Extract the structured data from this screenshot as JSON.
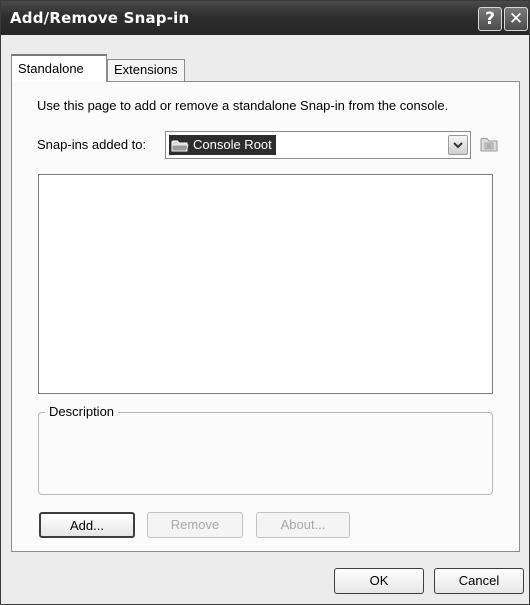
{
  "window": {
    "title": "Add/Remove Snap-in",
    "help_glyph": "?",
    "close_glyph": "✕"
  },
  "tabs": [
    {
      "label": "Standalone",
      "selected": true
    },
    {
      "label": "Extensions",
      "selected": false
    }
  ],
  "standalone": {
    "intro_text": "Use this page to add or remove a standalone Snap-in from the console.",
    "snapins_label": "Snap-ins added to:",
    "snapins_value": "Console Root",
    "snapins_value_icon": "folder-icon",
    "list_items": [],
    "description_label": "Description",
    "description_text": "",
    "buttons": {
      "add": "Add...",
      "remove": "Remove",
      "about": "About..."
    }
  },
  "footer": {
    "ok": "OK",
    "cancel": "Cancel"
  },
  "colors": {
    "titlebar": "#2e2e2e",
    "selection": "#2d2d2d",
    "dialog_bg": "#ececec"
  }
}
